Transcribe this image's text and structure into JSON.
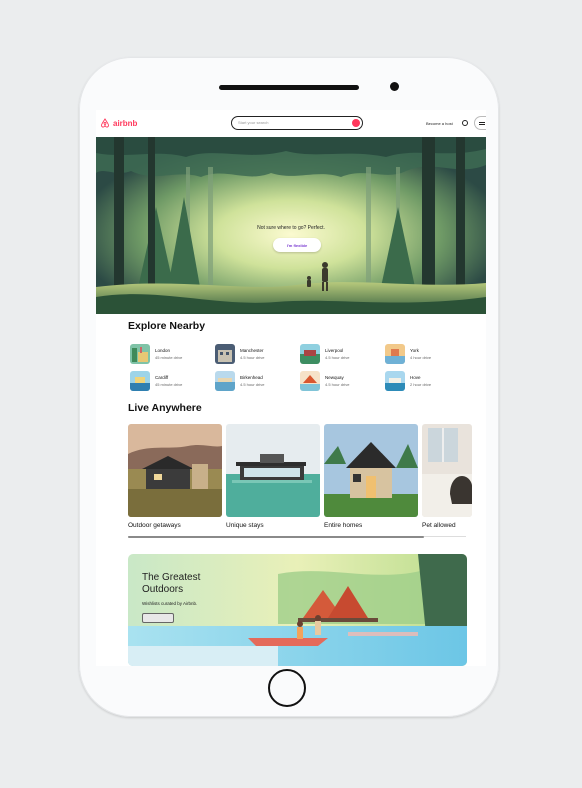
{
  "header": {
    "logo_text": "airbnb",
    "search_placeholder": "Start your search",
    "host_link": "Become a host",
    "brand_color": "#ff385c"
  },
  "hero": {
    "tagline": "Not sure where to go? Perfect.",
    "button_label": "I'm flexible"
  },
  "explore": {
    "title": "Explore Nearby",
    "items": [
      {
        "city": "London",
        "drive": "45 minute drive"
      },
      {
        "city": "Manchester",
        "drive": "4.5 hour drive"
      },
      {
        "city": "Liverpool",
        "drive": "4.5 hour drive"
      },
      {
        "city": "York",
        "drive": "4 hour drive"
      },
      {
        "city": "Cardiff",
        "drive": "45 minute drive"
      },
      {
        "city": "Birkenhead",
        "drive": "4.5 hour drive"
      },
      {
        "city": "Newquay",
        "drive": "4.5 hour drive"
      },
      {
        "city": "Hove",
        "drive": "2 hour drive"
      }
    ]
  },
  "live": {
    "title": "Live Anywhere",
    "cards": [
      {
        "label": "Outdoor getaways"
      },
      {
        "label": "Unique stays"
      },
      {
        "label": "Entire homes"
      },
      {
        "label": "Pet allowed"
      }
    ]
  },
  "promo": {
    "title": "The Greatest Outdoors",
    "subtitle": "Wishlists curated by Airbnb."
  },
  "icons": [
    "airbnb-logo-icon",
    "search-icon",
    "globe-icon",
    "menu-icon",
    "home-button-icon"
  ]
}
